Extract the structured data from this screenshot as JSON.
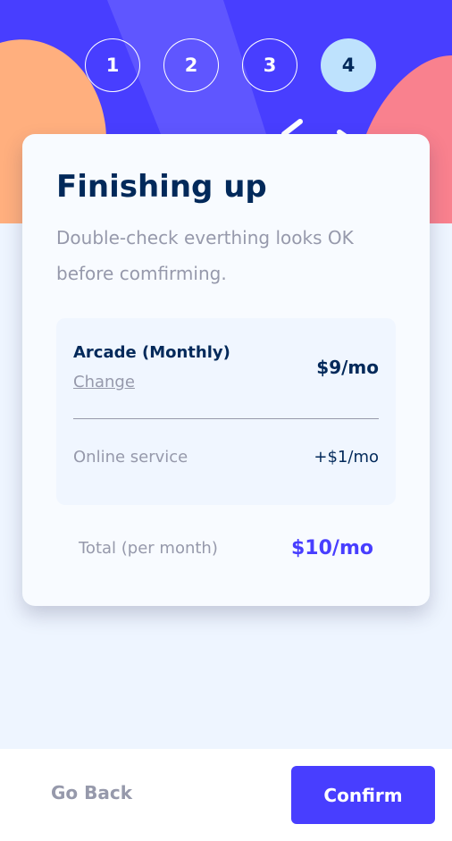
{
  "steps": [
    "1",
    "2",
    "3",
    "4"
  ],
  "active_step": 4,
  "header": {
    "title": "Finishing up",
    "subtitle": "Double-check everthing looks OK before comfirming."
  },
  "summary": {
    "plan_name": "Arcade (Monthly)",
    "change_label": "Change",
    "plan_price": "$9/mo",
    "addons": [
      {
        "name": "Online service",
        "price": "+$1/mo"
      }
    ]
  },
  "total": {
    "label": "Total (per month)",
    "price": "$10/mo"
  },
  "footer": {
    "back_label": "Go Back",
    "confirm_label": "Confirm"
  },
  "colors": {
    "accent": "#483eff",
    "marine": "#02295a",
    "gray": "#9699ab",
    "active_step_bg": "#bee2fd"
  }
}
